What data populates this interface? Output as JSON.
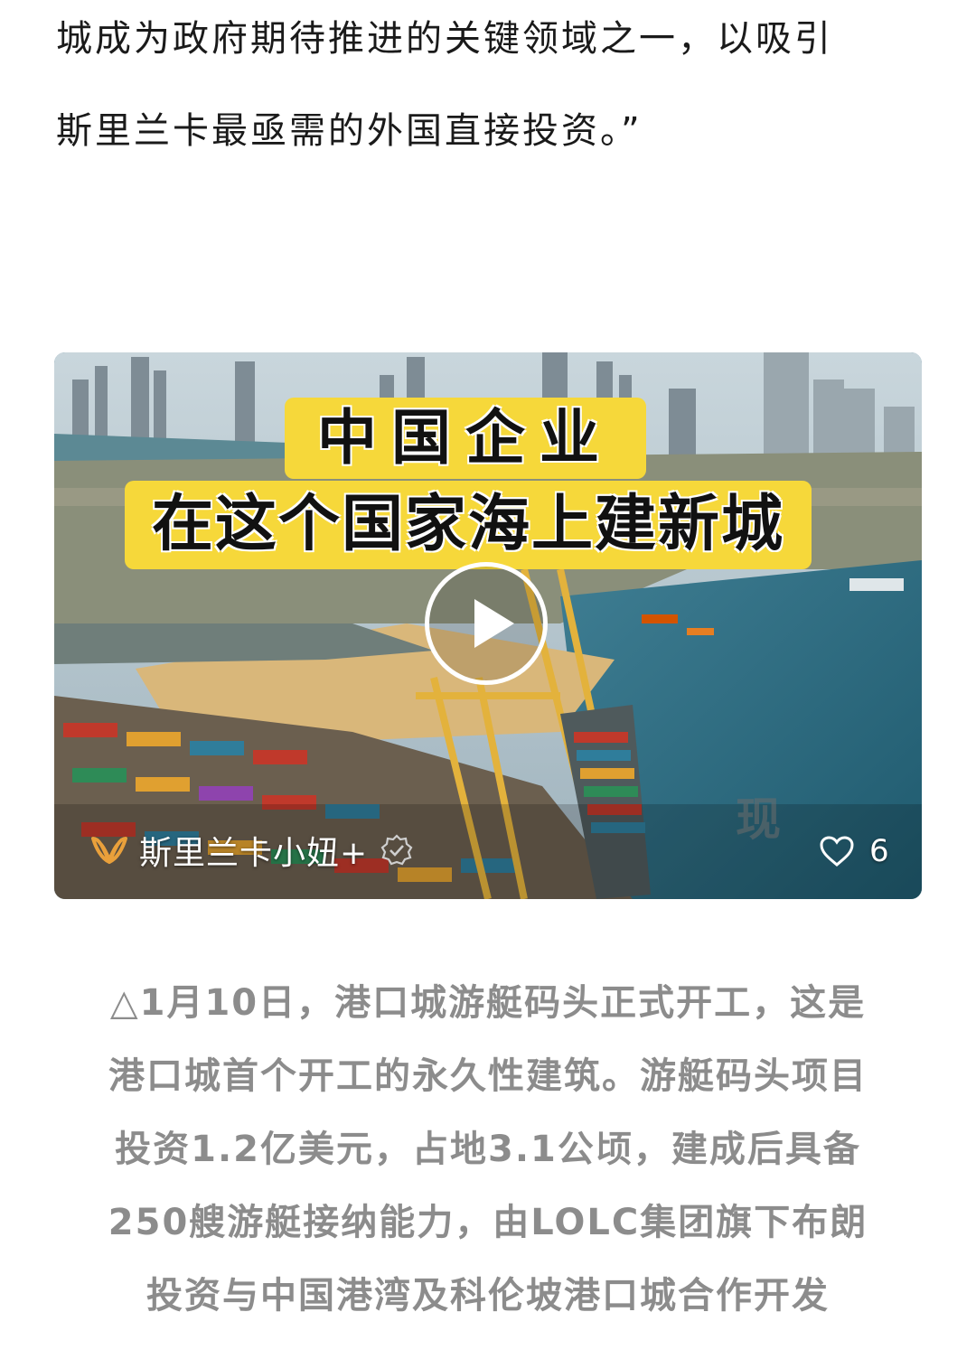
{
  "article": {
    "lines": [
      "城成为政府期待推进的关键领域之一，以吸引",
      "斯里兰卡最亟需的外国直接投资。”"
    ]
  },
  "video": {
    "headline_line1": "中国企业",
    "headline_line2": "在这个国家海上建新城",
    "channel_name": "斯里兰卡小妞+",
    "like_count": "6",
    "watermark_char": "现",
    "icons": {
      "play": "play-icon",
      "channel_logo": "channel-logo-icon",
      "verified": "verified-badge-icon",
      "like": "heart-icon"
    },
    "colors": {
      "headline_bg": "#f6d83a",
      "logo": "#e9a03b"
    }
  },
  "caption": {
    "lines": [
      "△1月10日，港口城游艇码头正式开工，这是",
      "港口城首个开工的永久性建筑。游艇码头项目",
      "投资1.2亿美元，占地3.1公顷，建成后具备",
      "250艘游艇接纳能力，由LOLC集团旗下布朗",
      "投资与中国港湾及科伦坡港口城合作开发"
    ]
  }
}
